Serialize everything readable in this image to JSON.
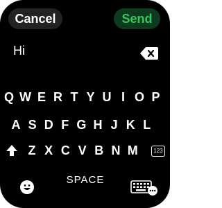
{
  "header": {
    "cancel_label": "Cancel",
    "send_label": "Send"
  },
  "input": {
    "value": "Hi"
  },
  "keyboard": {
    "row1": [
      "Q",
      "W",
      "E",
      "R",
      "T",
      "Y",
      "U",
      "I",
      "O",
      "P"
    ],
    "row2": [
      "A",
      "S",
      "D",
      "F",
      "G",
      "H",
      "J",
      "K",
      "L"
    ],
    "row3": [
      "Z",
      "X",
      "C",
      "V",
      "B",
      "N",
      "M"
    ],
    "numbers_key_label": "123",
    "space_label": "SPACE"
  },
  "icons": {
    "backspace": "backspace-icon",
    "shift": "shift-icon",
    "emoji": "emoji-icon",
    "keyboard_settings": "keyboard-more-icon"
  },
  "colors": {
    "background": "#000000",
    "send_text": "#34c759",
    "send_bg": "#0e3a20",
    "cancel_bg": "#232323"
  }
}
